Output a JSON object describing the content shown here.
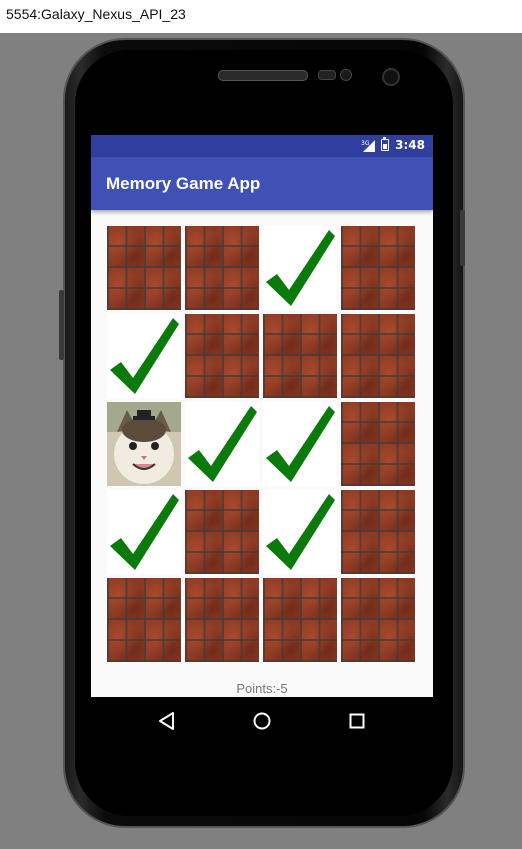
{
  "window": {
    "title": "5554:Galaxy_Nexus_API_23"
  },
  "status_bar": {
    "network": "3G",
    "time": "3:48"
  },
  "app_bar": {
    "title": "Memory Game App"
  },
  "board": {
    "rows": [
      [
        "brick",
        "brick",
        "check",
        "brick"
      ],
      [
        "check",
        "brick",
        "brick",
        "brick"
      ],
      [
        "cat",
        "check",
        "check",
        "brick"
      ],
      [
        "check",
        "brick",
        "check",
        "brick"
      ],
      [
        "brick",
        "brick",
        "brick",
        "brick"
      ]
    ]
  },
  "points_label": "Points:-5",
  "colors": {
    "primary": "#3F51B5",
    "primary_dark": "#303F9F",
    "check_green": "#0a7a0a"
  },
  "nav": {
    "back_icon": "back-triangle-icon",
    "home_icon": "home-circle-icon",
    "recents_icon": "recents-square-icon"
  }
}
